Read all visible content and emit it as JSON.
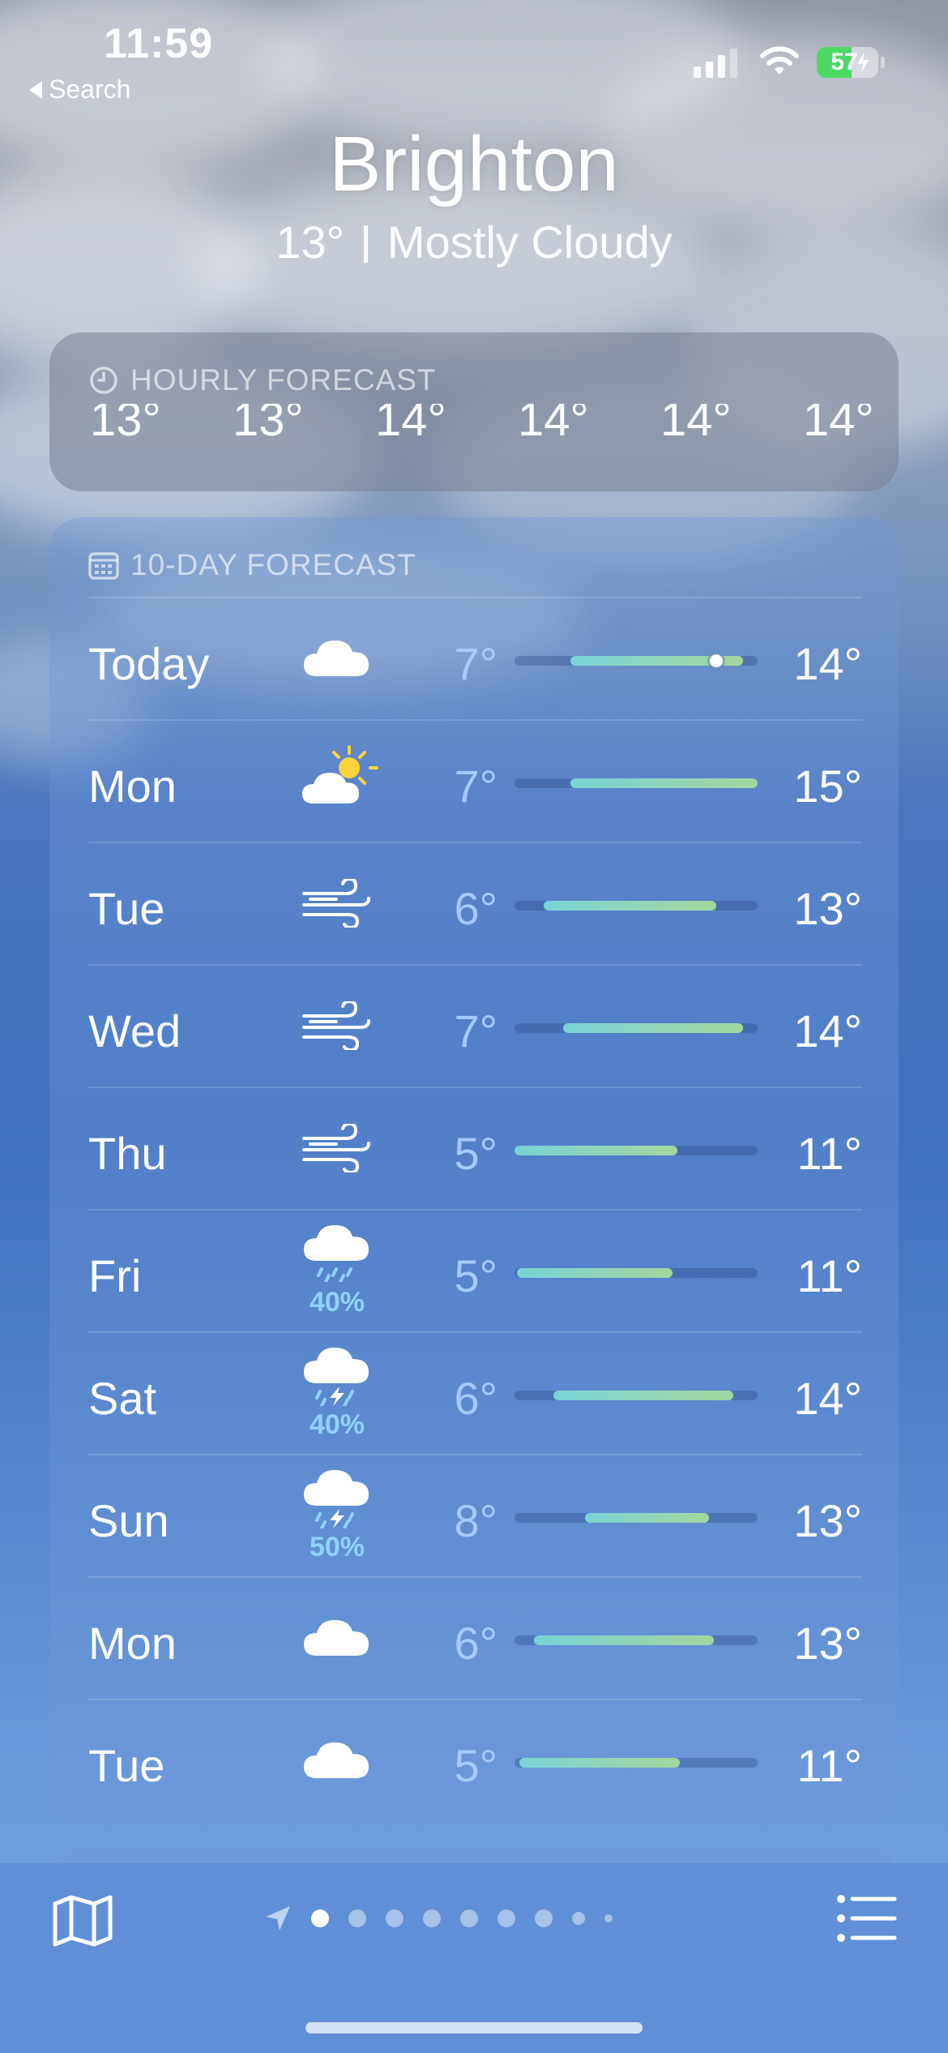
{
  "status_bar": {
    "time": "11:59",
    "back_label": "Search",
    "battery": "57",
    "battery_level": 0.57,
    "signal_bars": 3
  },
  "location": {
    "city": "Brighton",
    "current_temp": "13°",
    "condition": "Mostly Cloudy"
  },
  "hourly": {
    "title": "HOURLY FORECAST",
    "temps": [
      "13°",
      "13°",
      "14°",
      "14°",
      "14°",
      "14°"
    ]
  },
  "daily": {
    "title": "10-DAY FORECAST",
    "days": [
      {
        "day": "Today",
        "icon": "cloud-icon",
        "precip": "",
        "low": "7°",
        "high": "14°",
        "bar_start": 0.23,
        "bar_end": 0.94,
        "now": 0.83
      },
      {
        "day": "Mon",
        "icon": "partly-sunny-icon",
        "precip": "",
        "low": "7°",
        "high": "15°",
        "bar_start": 0.23,
        "bar_end": 1.0
      },
      {
        "day": "Tue",
        "icon": "wind-icon",
        "precip": "",
        "low": "6°",
        "high": "13°",
        "bar_start": 0.12,
        "bar_end": 0.83
      },
      {
        "day": "Wed",
        "icon": "wind-icon",
        "precip": "",
        "low": "7°",
        "high": "14°",
        "bar_start": 0.2,
        "bar_end": 0.94
      },
      {
        "day": "Thu",
        "icon": "wind-icon",
        "precip": "",
        "low": "5°",
        "high": "11°",
        "bar_start": 0.0,
        "bar_end": 0.67
      },
      {
        "day": "Fri",
        "icon": "rain-icon",
        "precip": "40%",
        "low": "5°",
        "high": "11°",
        "bar_start": 0.01,
        "bar_end": 0.65
      },
      {
        "day": "Sat",
        "icon": "thunderstorm-icon",
        "precip": "40%",
        "low": "6°",
        "high": "14°",
        "bar_start": 0.16,
        "bar_end": 0.9
      },
      {
        "day": "Sun",
        "icon": "thunderstorm-icon",
        "precip": "50%",
        "low": "8°",
        "high": "13°",
        "bar_start": 0.29,
        "bar_end": 0.8
      },
      {
        "day": "Mon",
        "icon": "cloud-icon",
        "precip": "",
        "low": "6°",
        "high": "13°",
        "bar_start": 0.08,
        "bar_end": 0.82
      },
      {
        "day": "Tue",
        "icon": "cloud-icon",
        "precip": "",
        "low": "5°",
        "high": "11°",
        "bar_start": 0.02,
        "bar_end": 0.68
      }
    ]
  },
  "bottom_bar": {
    "page_count": 8,
    "active_page": 0,
    "map_icon": "map-icon",
    "list_icon": "list-icon"
  }
}
